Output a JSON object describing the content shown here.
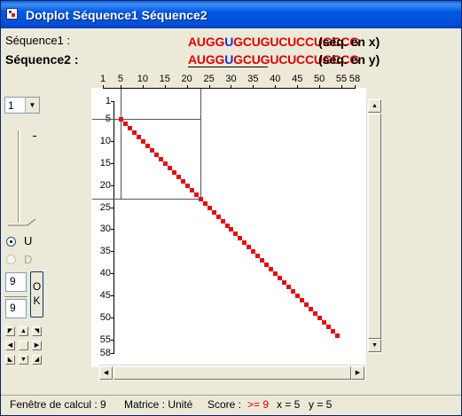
{
  "window": {
    "title": "Dotplot Séquence1 Séquence2"
  },
  "sequences": {
    "seq1_label": "Séquence1 :",
    "seq2_label": "Séquence2 :",
    "seq1_part1": "AUGG",
    "seq1_part2": "U",
    "seq1_part3": "GCUGUCUCCUGCCG",
    "seq2_part1": "AUGG",
    "seq2_part2": "U",
    "seq2_part3": "GCUGUCUCCUGCCG",
    "seq1_note": "(séq. en x)",
    "seq2_note": "(séq. en y)"
  },
  "colors": {
    "match": "#e01010",
    "seq_default": "#e00000",
    "seq_highlight": "#1a2fd0"
  },
  "plot": {
    "x_ticks": [
      "1",
      "5",
      "10",
      "15",
      "20",
      "25",
      "30",
      "35",
      "40",
      "45",
      "50",
      "55",
      "58"
    ],
    "y_ticks": [
      "1",
      "5",
      "10",
      "15",
      "20",
      "25",
      "30",
      "35",
      "40",
      "45",
      "50",
      "55",
      "58"
    ],
    "axis_range": [
      1,
      58
    ],
    "diagonal_start": 5,
    "diagonal_end": 54,
    "crosshair_point": {
      "x": 5,
      "y": 5
    },
    "window_end": {
      "x": 23,
      "y": 23
    }
  },
  "controls": {
    "combo_value": "1",
    "slider_mark": "-",
    "radio_u": "U",
    "radio_d": "D",
    "spin1": "9",
    "spin2": "9",
    "ok_label": "O\nK"
  },
  "status": {
    "window_label": "Fenêtre de calcul : 9",
    "matrix_label": "Matrice : Unité",
    "score_label": "Score :",
    "score_value": ">= 9",
    "x_value": "x = 5",
    "y_value": "y = 5"
  }
}
